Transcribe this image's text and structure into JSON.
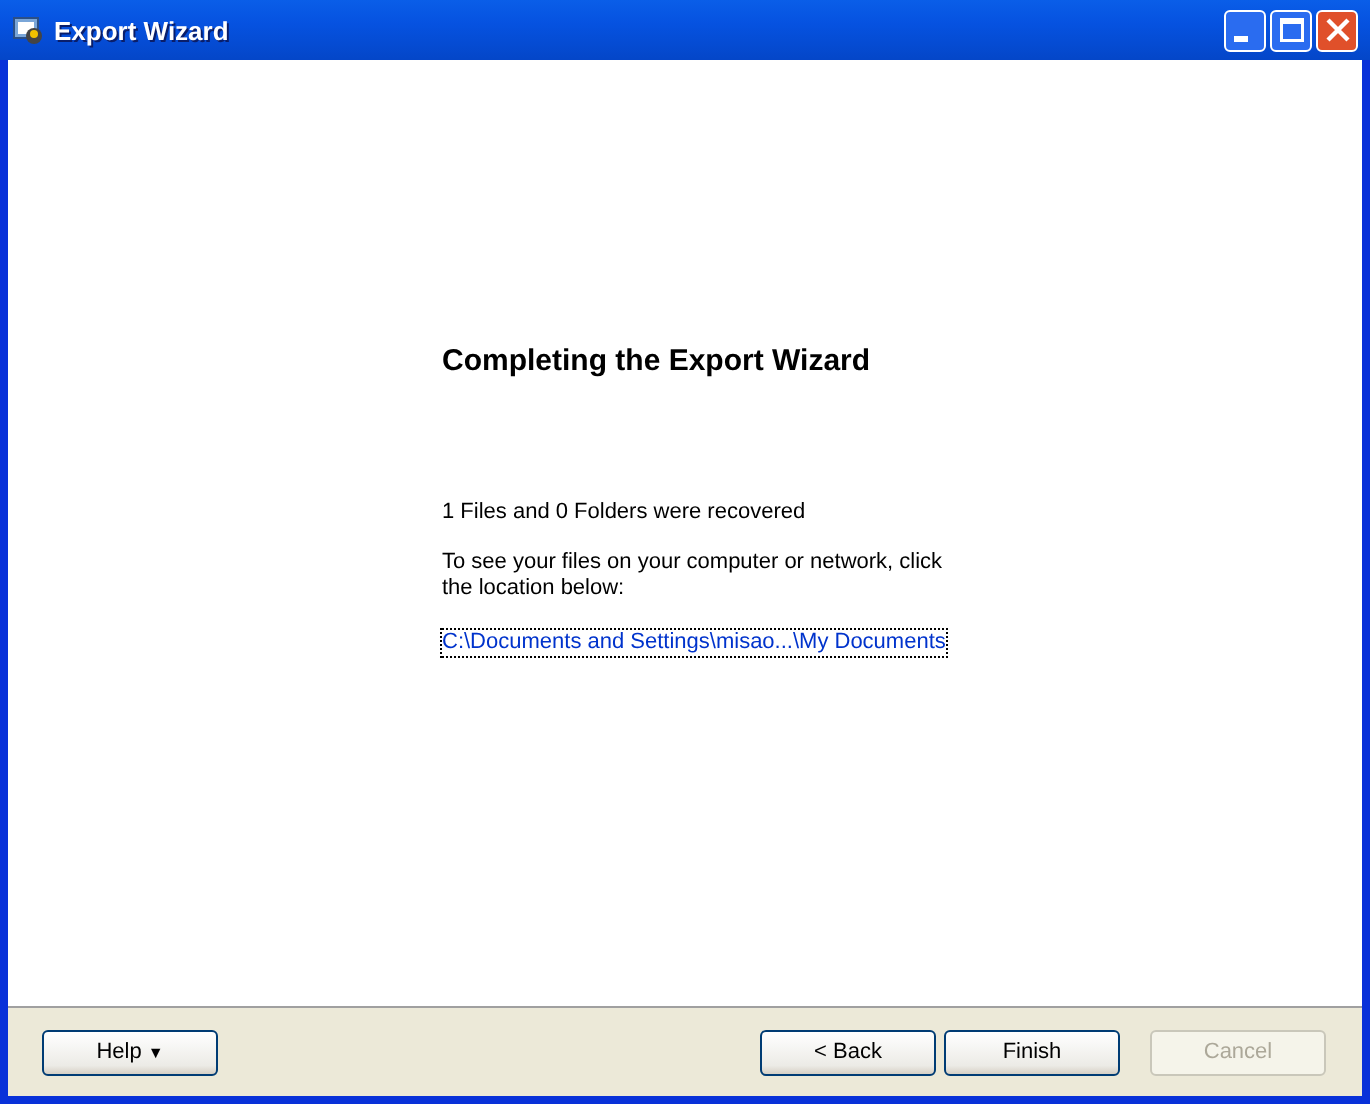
{
  "window": {
    "title": "Export Wizard"
  },
  "heading": "Completing the Export Wizard",
  "summary": "1 Files and 0 Folders were recovered",
  "instruction": "To see your files on your computer or network, click the location below:",
  "location_link": "C:\\Documents and Settings\\misao...\\My Documents",
  "buttons": [
    {
      "kind": "menu",
      "label": "Help",
      "caret": "▼",
      "disabled": false
    },
    {
      "kind": "push",
      "label": "< Back",
      "disabled": false
    },
    {
      "kind": "push",
      "label": "Finish",
      "disabled": false
    },
    {
      "kind": "push",
      "label": "Cancel",
      "disabled": true
    }
  ]
}
